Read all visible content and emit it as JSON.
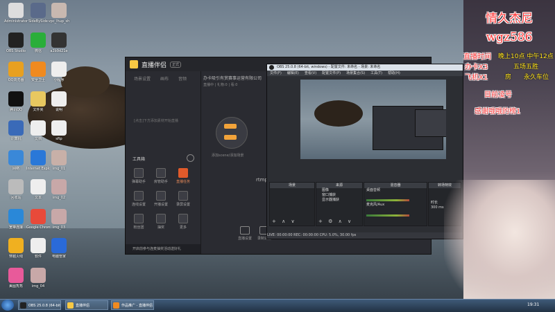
{
  "desktop": {
    "icons": [
      {
        "label": "Administrator",
        "color": "#ddd"
      },
      {
        "label": "SideBySide",
        "color": "#5a6a8a"
      },
      {
        "label": "vpc_lhup_sh",
        "color": "#c8b8b0"
      },
      {
        "label": "OBS Studio",
        "color": "#222"
      },
      {
        "label": "微信",
        "color": "#2aae3a"
      },
      {
        "label": "a2b9d21e",
        "color": "#333"
      },
      {
        "label": "QQ浏览器",
        "color": "#e8a020"
      },
      {
        "label": "安全卫士",
        "color": "#f08a20"
      },
      {
        "label": "小程序",
        "color": "#eee"
      },
      {
        "label": "腾讯QQ",
        "color": "#111"
      },
      {
        "label": "文件夹",
        "color": "#e8c860"
      },
      {
        "label": "说明",
        "color": "#eee"
      },
      {
        "label": "计算机",
        "color": "#3a6ab8"
      },
      {
        "label": "文档",
        "color": "#eee"
      },
      {
        "label": "sftp",
        "color": "#eee"
      },
      {
        "label": "网络",
        "color": "#3a88d8"
      },
      {
        "label": "Internet Explorer",
        "color": "#2a78d8"
      },
      {
        "label": "img_01",
        "color": "#c8b0a8"
      },
      {
        "label": "回收站",
        "color": "#bbb"
      },
      {
        "label": "文本",
        "color": "#eee"
      },
      {
        "label": "img_02",
        "color": "#c8a8a8"
      },
      {
        "label": "宽带连接",
        "color": "#2a88d8"
      },
      {
        "label": "Google Chrome",
        "color": "#e84a3a"
      },
      {
        "label": "img_03",
        "color": "#c8a8a8"
      },
      {
        "label": "穿越火线",
        "color": "#f0b020"
      },
      {
        "label": "软件",
        "color": "#eee"
      },
      {
        "label": "电脑管家",
        "color": "#2a6ad8"
      },
      {
        "label": "美图秀秀",
        "color": "#e85a9a"
      },
      {
        "label": "img_04",
        "color": "#c8a8a8"
      }
    ]
  },
  "zhibo": {
    "app_name": "直播伴侣",
    "badge": "正式",
    "tabs": [
      "场景设置",
      "画布",
      "音频"
    ],
    "hint": "[点击]下方添加素材开始直播",
    "tools_title": "工具箱",
    "tools": [
      "弹幕助手",
      "房管助手",
      "直播任务",
      "连线设置",
      "开播设置",
      "录屏设置",
      "粉丝团",
      "抽奖",
      "更多"
    ],
    "company": "办卡吸引有赏赛事运营有限公司",
    "sub": "直播中 | 礼物:0 | 看:0",
    "scene_caption": "添加scene/添加场景",
    "rtmp": "rtmp推",
    "bottom_items": [
      "直播设置",
      "录制设置"
    ],
    "notice": "开启前参与连麦抽奖活动送好礼"
  },
  "obs": {
    "title": "OBS 25.0.8 (64-bit, windows) - 配置文件: 未命名 - 场景: 未命名",
    "menu": [
      "文件(F)",
      "编辑(E)",
      "查看(V)",
      "配置文件(P)",
      "场景集合(S)",
      "工具(T)",
      "帮助(H)"
    ],
    "panels": {
      "scenes": "场景",
      "sources": "来源",
      "mixer": "混音器",
      "transitions": "转场特效"
    },
    "source_items": [
      "图像",
      "窗口捕获",
      "显示器捕获"
    ],
    "mixer_items": [
      "桌面音频",
      "麦克风/Aux"
    ],
    "duration_label": "时长",
    "duration_value": "300 ms",
    "status": "LIVE: 00:00:00   REC: 00:00:00   CPU: 5.0%, 30.00 fps"
  },
  "overlay": {
    "title": "情久杰尼",
    "id": "wgz586",
    "schedule_label": "直播时间",
    "schedule_time": "晚上10点 中午12点",
    "line_card": "办卡X3",
    "line_five": "五场五胜",
    "line_plane": "飞机X1",
    "line_room": "房",
    "line_car": "永久车位",
    "target": "目前凌号",
    "thanks": "感谢哦哦的榜1"
  },
  "taskbar": {
    "items": [
      {
        "label": "OBS 25.0.8 (64-bit)",
        "color": "#222"
      },
      {
        "label": "直播伴侣",
        "color": "#f7c844"
      },
      {
        "label": "作品推广 - 直播伴侣",
        "color": "#f08a20"
      }
    ],
    "tray_time": "19:31"
  }
}
